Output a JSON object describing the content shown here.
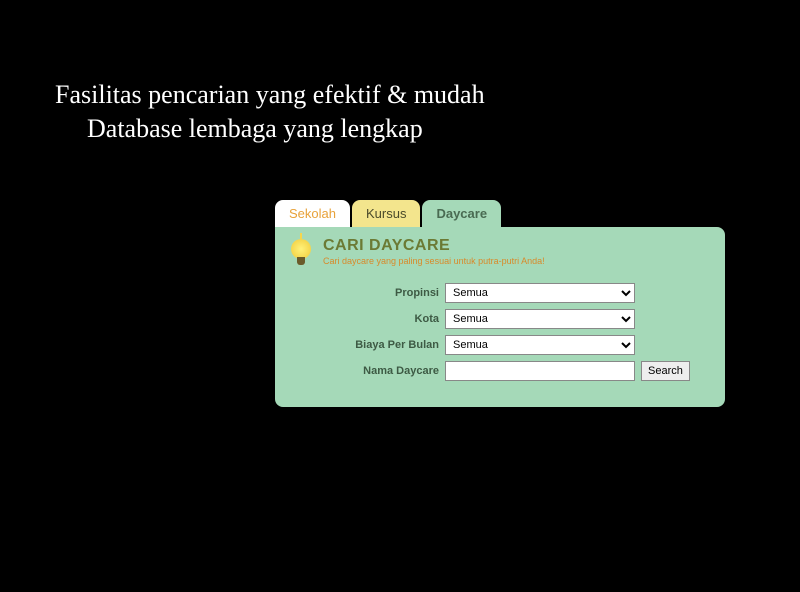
{
  "headline": {
    "line1": "Fasilitas pencarian yang efektif & mudah",
    "line2": "Database lembaga yang lengkap"
  },
  "tabs": {
    "sekolah": "Sekolah",
    "kursus": "Kursus",
    "daycare": "Daycare"
  },
  "panel": {
    "title": "CARI DAYCARE",
    "subtitle": "Cari daycare yang paling sesuai untuk putra-putri Anda!"
  },
  "form": {
    "propinsi_label": "Propinsi",
    "propinsi_value": "Semua",
    "kota_label": "Kota",
    "kota_value": "Semua",
    "biaya_label": "Biaya Per Bulan",
    "biaya_value": "Semua",
    "nama_label": "Nama Daycare",
    "nama_value": "",
    "search_label": "Search"
  }
}
